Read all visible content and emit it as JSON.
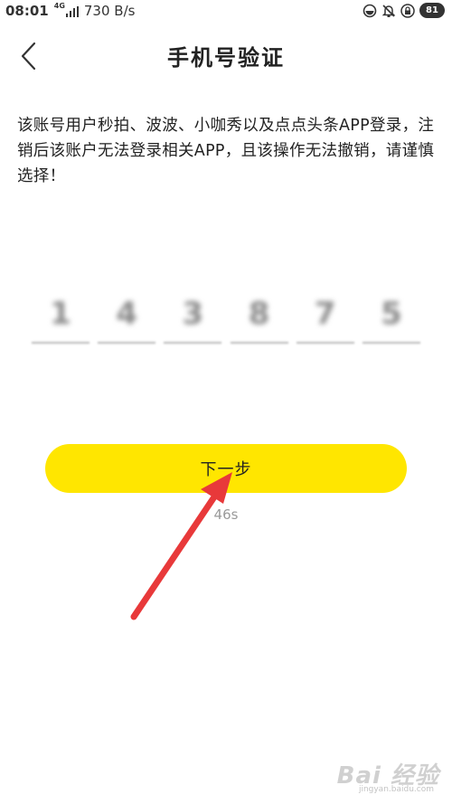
{
  "status_bar": {
    "time": "08:01",
    "network_type": "4G",
    "speed": "730 B/s",
    "battery": "81",
    "icons": [
      "signal-icon",
      "sync-icon",
      "mute-icon",
      "lock-icon"
    ]
  },
  "header": {
    "back_icon": "chevron-left-icon",
    "title": "手机号验证"
  },
  "notice": {
    "text": "该账号用户秒拍、波波、小咖秀以及点点头条APP登录，注销后该账户无法登录相关APP，且该操作无法撤销，请谨慎选择！"
  },
  "code": {
    "digits": [
      "1",
      "4",
      "3",
      "8",
      "7",
      "5"
    ]
  },
  "next_button": {
    "label": "下一步"
  },
  "countdown": {
    "text": "46s"
  },
  "watermark": {
    "brand": "Bai 经验",
    "url": "jingyan.baidu.com"
  },
  "colors": {
    "accent": "#ffe600",
    "annotation_arrow": "#e8393a",
    "countdown_text": "#9a9a9a"
  }
}
